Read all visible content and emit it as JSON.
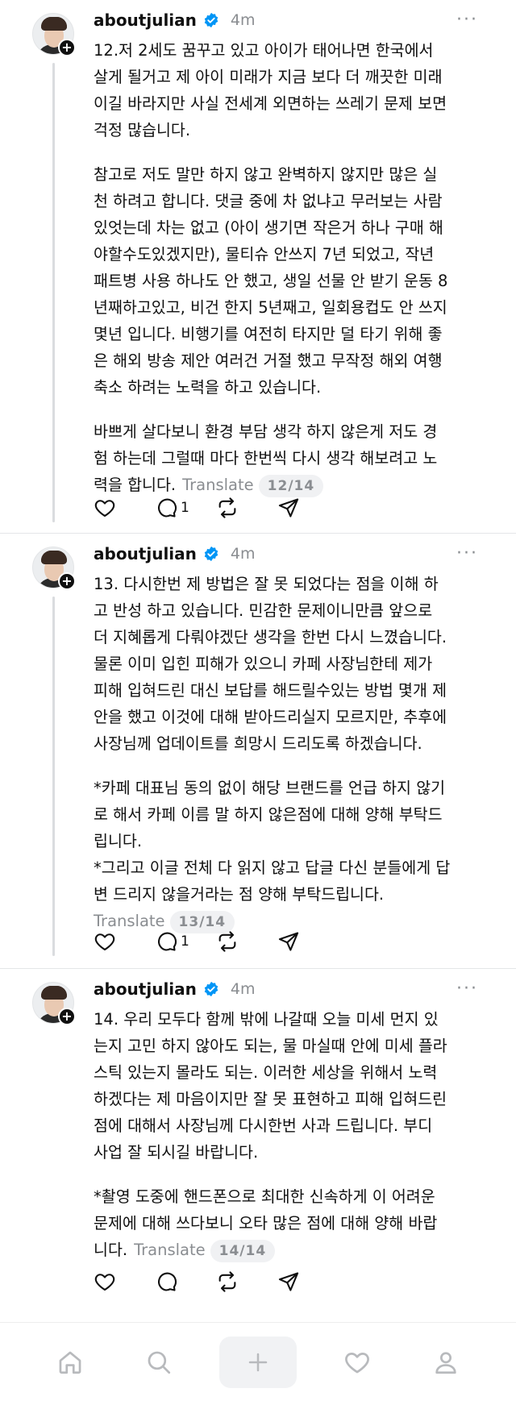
{
  "posts": [
    {
      "username": "aboutjulian",
      "time": "4m",
      "paragraphs": [
        "12.저 2세도 꿈꾸고 있고 아이가 태어나면 한국에서\n살게 될거고 제 아이 미래가 지금 보다 더 깨끗한 미래\n이길 바라지만 사실 전세계 외면하는 쓰레기 문제 보면\n걱정 많습니다.",
        "참고로 저도 말만 하지 않고 완벽하지 않지만 많은 실\n천 하려고 합니다. 댓글 중에 차 없냐고 무러보는 사람\n있엇는데 차는 없고 (아이 생기면 작은거 하나 구매 해\n야할수도있겠지만), 물티슈 안쓰지 7년 되었고, 작년\n패트병 사용 하나도 안 했고, 생일 선물 안 받기 운동 8\n년째하고있고, 비건 한지 5년째고, 일회용컵도 안 쓰지\n몇년 입니다. 비행기를 여전히 타지만 덜 타기 위해 좋\n은 해외 방송 제안 여러건 거절 했고 무작정 해외 여행\n축소 하려는 노력을 하고 있습니다.",
        "바쁘게 살다보니 환경 부담 생각 하지 않은게 저도 경\n험 하는데 그럴때 마다 한번씩 다시 생각 해보려고 노\n력을 합니다."
      ],
      "translate": "Translate",
      "page": "12/14",
      "reply_count": "1"
    },
    {
      "username": "aboutjulian",
      "time": "4m",
      "paragraphs": [
        "13. 다시한번 제 방법은 잘 못 되었다는 점을 이해 하\n고 반성 하고 있습니다. 민감한 문제이니만큼 앞으로\n더 지혜롭게 다뤄야겠단 생각을 한번 다시 느꼈습니다.\n물론 이미 입힌 피해가 있으니 카페 사장님한테 제가\n피해 입혀드린 대신 보답를 해드릴수있는 방법 몇개 제\n안을 했고 이것에 대해 받아드리실지 모르지만, 추후에\n사장님께 업데이트를 희망시 드리도록 하겠습니다.",
        "*카페 대표님 동의 없이 해당 브랜드를 언급 하지 않기\n로 해서 카페 이름 말 하지 않은점에 대해 양해 부탁드\n립니다.\n*그리고 이글 전체 다 읽지 않고 답글 다신 분들에게 답\n변 드리지 않을거라는 점 양해 부탁드립니다."
      ],
      "translate": "Translate",
      "page": "13/14",
      "reply_count": "1"
    },
    {
      "username": "aboutjulian",
      "time": "4m",
      "paragraphs": [
        "14. 우리 모두다 함께 밖에 나갈때 오늘 미세 먼지 있\n는지 고민 하지 않아도 되는, 물 마실때 안에 미세 플라\n스틱 있는지 몰라도 되는. 이러한 세상을 위해서 노력\n하겠다는 제 마음이지만 잘 못 표현하고 피해 입혀드린\n점에 대해서 사장님께 다시한번 사과 드립니다. 부디\n사업 잘 되시길 바랍니다.",
        "*촬영 도중에 핸드폰으로 최대한 신속하게 이 어려운\n문제에 대해 쓰다보니 오타 많은 점에 대해 양해 바랍\n니다."
      ],
      "translate": "Translate",
      "page": "14/14",
      "reply_count": ""
    }
  ],
  "nav": [
    "home-icon",
    "search-icon",
    "create-icon",
    "activity-icon",
    "profile-icon"
  ]
}
